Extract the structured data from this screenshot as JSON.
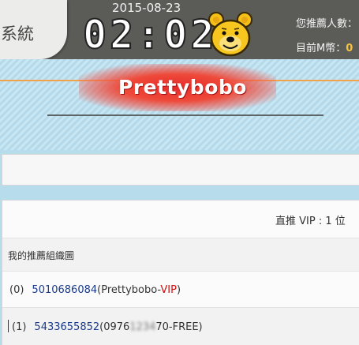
{
  "header": {
    "login_label": "入系統",
    "date": "2015-08-23",
    "clock": "02:02",
    "recommend_count_label": "您推薦人數：",
    "coin_label": "目前M幣：",
    "coin_value": "0"
  },
  "brand": {
    "name": "Prettybobo"
  },
  "summary": {
    "direct_vip": "直推 VIP : 1 位"
  },
  "tree": {
    "title": "我的推薦組織圖",
    "nodes": [
      {
        "level": "(0)",
        "id": "5010686084",
        "name_prefix": "(Prettybobo-",
        "tier": "VIP",
        "name_suffix": ")"
      },
      {
        "level": "(1)",
        "id": "5433655852",
        "name_prefix": "(0976",
        "masked": "1234",
        "name_suffix": "70-FREE)"
      }
    ]
  },
  "colors": {
    "header_bg": "#5b5b58",
    "stripe_bg": "#b7dcec",
    "brand_red": "#e62a2a",
    "link_blue": "#1a3a8c",
    "vip_red": "#d01010"
  },
  "icons": {
    "mascot": "bear-face-icon"
  }
}
